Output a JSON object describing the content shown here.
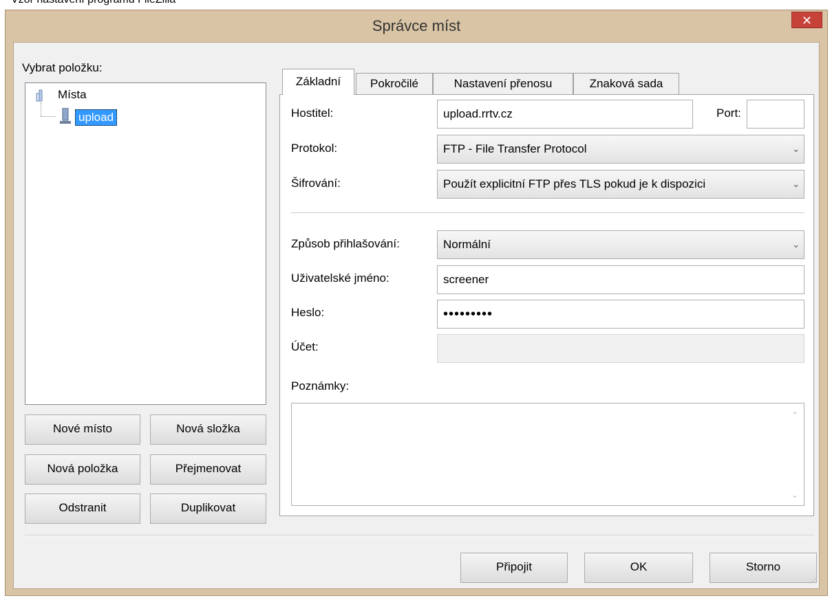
{
  "caption": "Vzor nastavení programu FileZilla",
  "window": {
    "title": "Správce míst",
    "close_glyph": "✕"
  },
  "left": {
    "select_label": "Vybrat položku:",
    "tree": {
      "root_label": "Místa",
      "child_label": "upload",
      "root_icon": "folder-icon",
      "child_icon": "server-icon"
    },
    "buttons": {
      "new_site": "Nové místo",
      "new_folder": "Nová složka",
      "new_bookmark": "Nová položka",
      "rename": "Přejmenovat",
      "delete": "Odstranit",
      "duplicate": "Duplikovat"
    }
  },
  "tabs": [
    "Základní",
    "Pokročilé",
    "Nastavení přenosu",
    "Znaková sada"
  ],
  "general": {
    "host_label": "Hostitel:",
    "host_value": "upload.rrtv.cz",
    "port_label": "Port:",
    "port_value": "",
    "protocol_label": "Protokol:",
    "protocol_value": "FTP - File Transfer Protocol",
    "encryption_label": "Šifrování:",
    "encryption_value": "Použít explicitní FTP přes TLS pokud je k dispozici",
    "logon_type_label": "Způsob přihlašování:",
    "logon_type_value": "Normální",
    "user_label": "Uživatelské jméno:",
    "user_value": "screener",
    "password_label": "Heslo:",
    "password_value": "•••••••••",
    "account_label": "Účet:",
    "account_value": "",
    "notes_label": "Poznámky:",
    "notes_value": ""
  },
  "footer": {
    "connect": "Připojit",
    "ok": "OK",
    "cancel": "Storno"
  },
  "colors": {
    "selection": "#3399ff",
    "close": "#c7433a",
    "frame": "#d9c4a5"
  }
}
